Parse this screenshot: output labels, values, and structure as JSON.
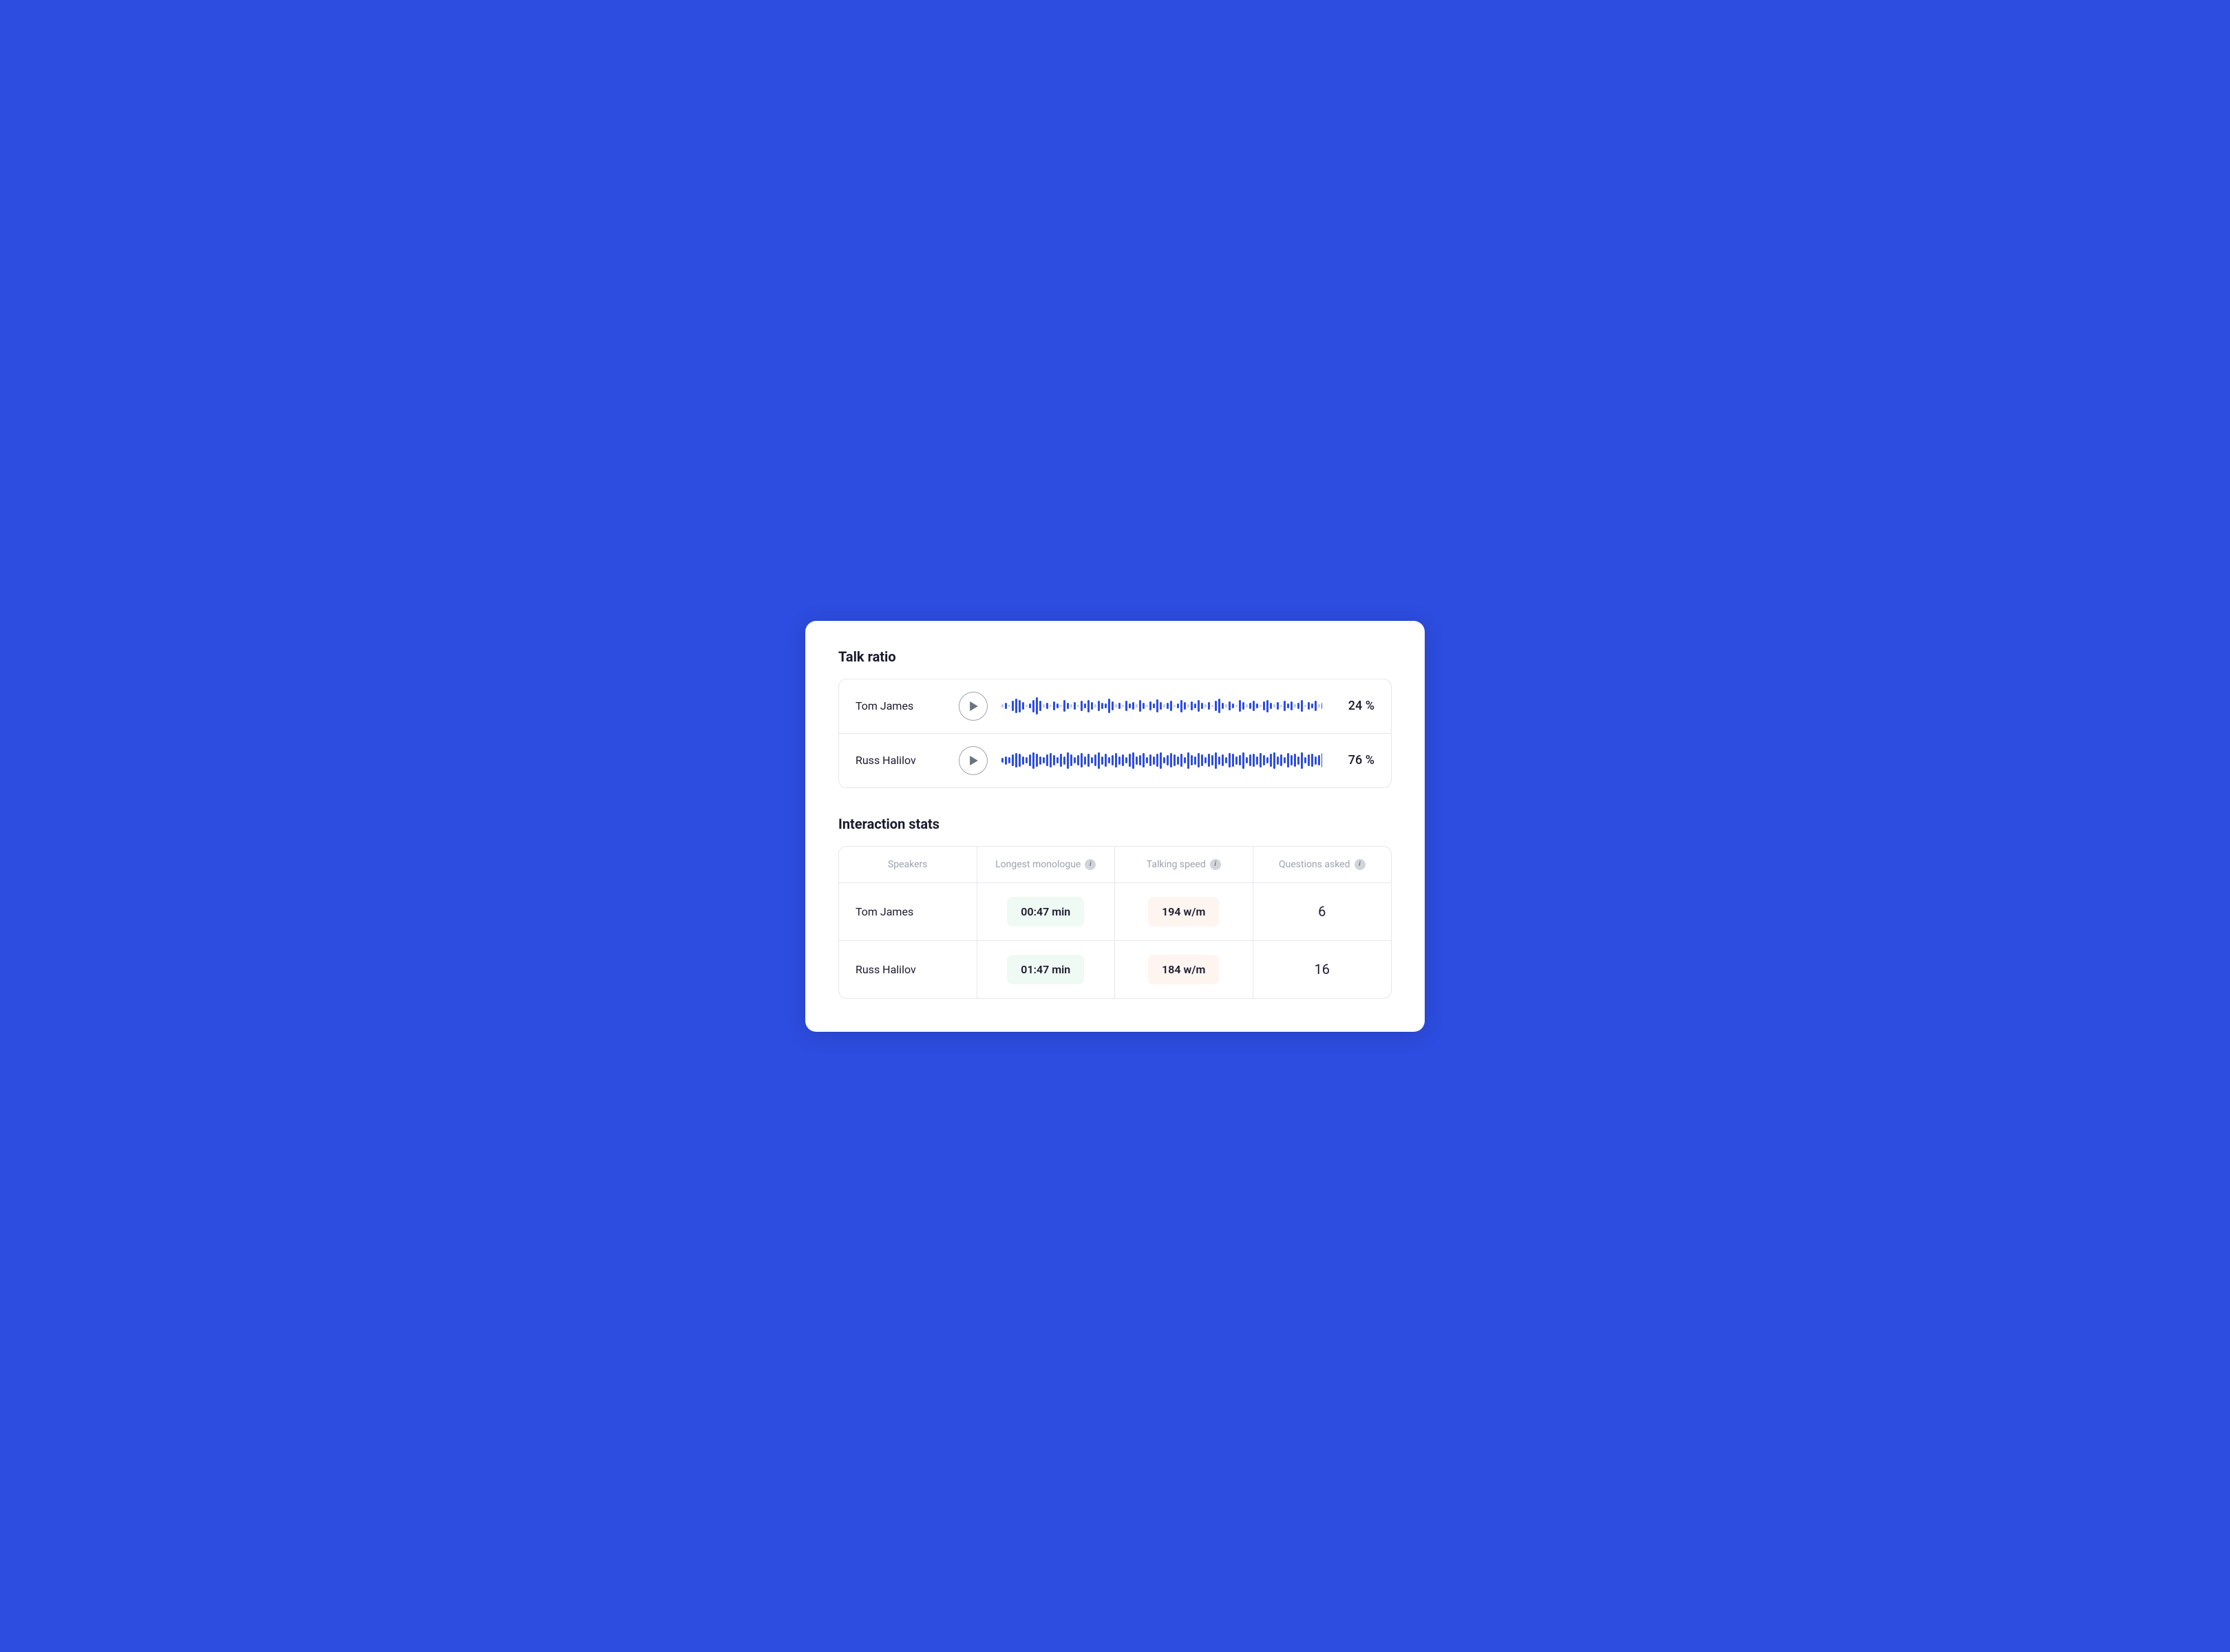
{
  "talk_ratio": {
    "title": "Talk ratio",
    "speakers": [
      {
        "name": "Tom James",
        "percent": "24 %",
        "waveform_density": "low"
      },
      {
        "name": "Russ Halilov",
        "percent": "76 %",
        "waveform_density": "high"
      }
    ]
  },
  "interaction_stats": {
    "title": "Interaction stats",
    "columns": [
      "Speakers",
      "Longest monologue",
      "Talking speed",
      "Questions asked"
    ],
    "rows": [
      {
        "speaker": "Tom James",
        "longest_monologue": "00:47 min",
        "talking_speed": "194 w/m",
        "questions_asked": "6"
      },
      {
        "speaker": "Russ Halilov",
        "longest_monologue": "01:47 min",
        "talking_speed": "184 w/m",
        "questions_asked": "16"
      }
    ]
  },
  "info_icon_label": "i"
}
